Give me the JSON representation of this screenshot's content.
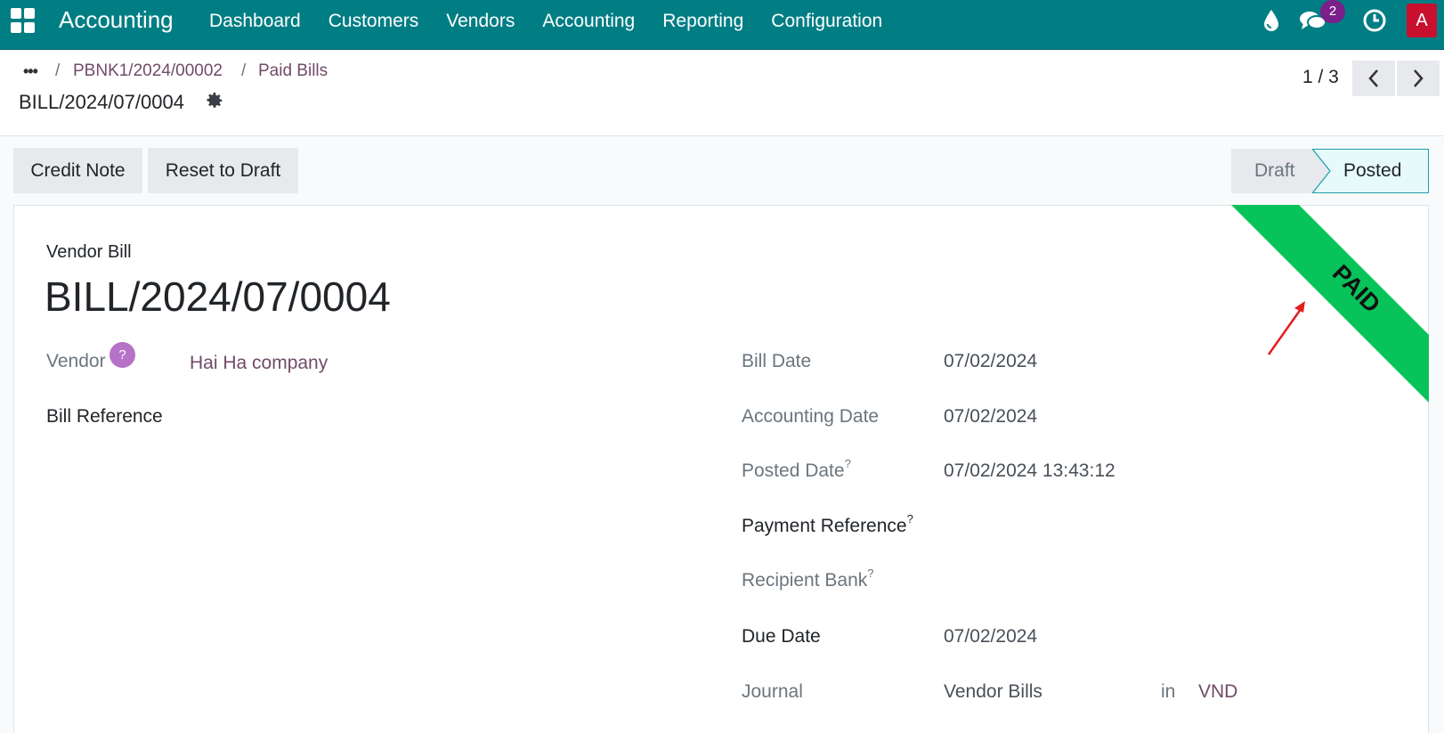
{
  "navbar": {
    "brand": "Accounting",
    "menu": [
      "Dashboard",
      "Customers",
      "Vendors",
      "Accounting",
      "Reporting",
      "Configuration"
    ],
    "messages_badge": "2",
    "avatar_initial": "A",
    "bg_color": "#017e84"
  },
  "breadcrumb": {
    "items": [
      "PBNK1/2024/00002",
      "Paid Bills"
    ],
    "current": "BILL/2024/07/0004"
  },
  "pager": {
    "value": "1 / 3"
  },
  "actions": {
    "credit_note": "Credit Note",
    "reset_to_draft": "Reset to Draft"
  },
  "status": {
    "stages": [
      "Draft",
      "Posted"
    ],
    "active": "Posted"
  },
  "ribbon": {
    "text": "PAID",
    "color": "#08c35a"
  },
  "form": {
    "doc_type": "Vendor Bill",
    "name": "BILL/2024/07/0004",
    "vendor_label": "Vendor",
    "vendor_help": "?",
    "vendor_value": "Hai Ha company",
    "bill_reference_label": "Bill Reference",
    "bill_date_label": "Bill Date",
    "bill_date": "07/02/2024",
    "accounting_date_label": "Accounting Date",
    "accounting_date": "07/02/2024",
    "posted_date_label": "Posted Date",
    "posted_date": "07/02/2024 13:43:12",
    "payment_reference_label": "Payment Reference",
    "recipient_bank_label": "Recipient Bank",
    "due_date_label": "Due Date",
    "due_date": "07/02/2024",
    "journal_label": "Journal",
    "journal_value": "Vendor Bills",
    "journal_in": "in",
    "currency": "VND",
    "help_mark": "?"
  }
}
